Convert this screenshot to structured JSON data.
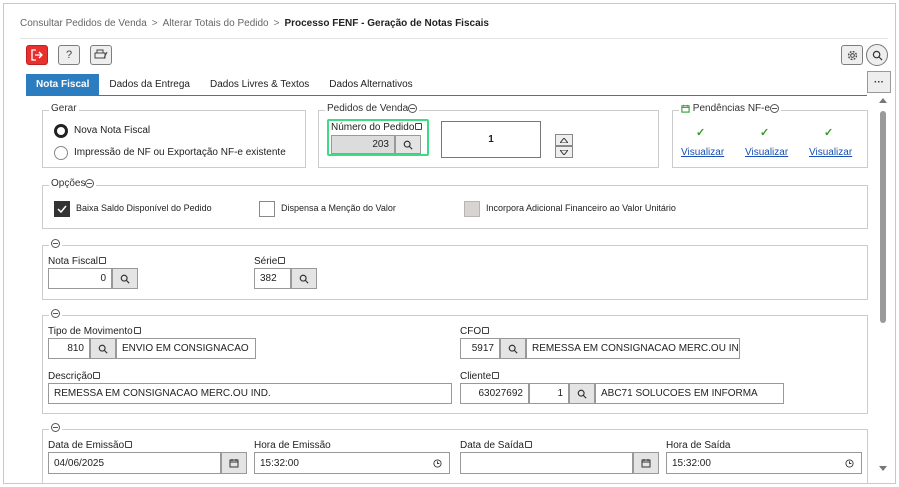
{
  "breadcrumb": {
    "item1": "Consultar Pedidos de Venda",
    "item2": "Alterar Totais do Pedido",
    "item3": "Processo FENF - Geração de Notas Fiscais",
    "sep": ">"
  },
  "toolbar": {
    "help_glyph": "?"
  },
  "tabs": [
    "Nota Fiscal",
    "Dados da Entrega",
    "Dados Livres & Textos",
    "Dados Alternativos"
  ],
  "more_glyph": "···",
  "gerar": {
    "legend": "Gerar",
    "options": [
      "Nova Nota Fiscal",
      "Impressão de NF ou Exportação NF-e existente"
    ],
    "selected": 0
  },
  "pedidos": {
    "legend": "Pedidos de Venda",
    "numero_label": "Número do Pedido",
    "numero_value": "203",
    "quantity": "1"
  },
  "pendencias": {
    "legend": "Pendências NF-e",
    "links": [
      "Visualizar",
      "Visualizar",
      "Visualizar"
    ],
    "check_glyph": "✓"
  },
  "opcoes": {
    "legend": "Opções",
    "items": [
      {
        "label": "Baixa Saldo Disponível do Pedido",
        "checked": true
      },
      {
        "label": "Dispensa a Menção do Valor",
        "checked": false
      },
      {
        "label": "Incorpora Adicional Financeiro ao Valor Unitário",
        "checked": false,
        "disabled": true
      }
    ]
  },
  "nf": {
    "nota_label": "Nota Fiscal",
    "nota_value": "0",
    "serie_label": "Série",
    "serie_value": "382"
  },
  "mov": {
    "tipo_label": "Tipo de Movimento",
    "tipo_code": "810",
    "tipo_desc": "ENVIO EM CONSIGNACAO",
    "cfo_label": "CFO",
    "cfo_code": "5917",
    "cfo_desc": "REMESSA EM CONSIGNACAO MERC.OU IND.",
    "desc_label": "Descrição",
    "desc_value": "REMESSA EM CONSIGNACAO MERC.OU IND.",
    "cliente_label": "Cliente",
    "cliente_code": "63027692",
    "cliente_seq": "1",
    "cliente_name": "ABC71 SOLUCOES EM INFORMA"
  },
  "datas": {
    "emissao_label": "Data de Emissão",
    "emissao_value": "04/06/2025",
    "hora_emissao_label": "Hora de Emissão",
    "hora_emissao_value": "15:32:00",
    "saida_label": "Data de Saída",
    "saida_value": "",
    "hora_saida_label": "Hora de Saída",
    "hora_saida_value": "15:32:00"
  },
  "colors": {
    "accent": "#2b7dc0",
    "exit": "#e8302f",
    "link": "#1a4fb5",
    "ok": "#2e9b2e",
    "focus": "#3ddc84"
  }
}
